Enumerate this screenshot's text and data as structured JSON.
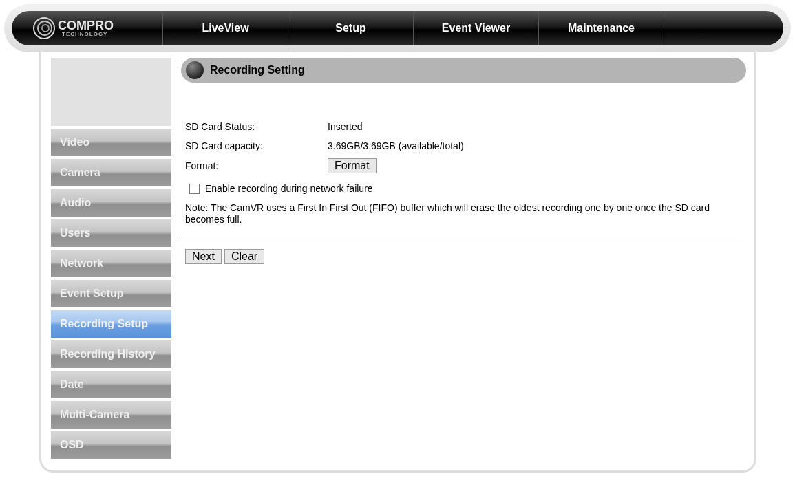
{
  "logo": {
    "name": "COMPRO",
    "tagline": "TECHNOLOGY"
  },
  "nav": [
    {
      "label": "LiveView",
      "selected": false
    },
    {
      "label": "Setup",
      "selected": false
    },
    {
      "label": "Event Viewer",
      "selected": false
    },
    {
      "label": "Maintenance",
      "selected": false
    }
  ],
  "sidebar": {
    "items": [
      {
        "label": "Video",
        "selected": false
      },
      {
        "label": "Camera",
        "selected": false
      },
      {
        "label": "Audio",
        "selected": false
      },
      {
        "label": "Users",
        "selected": false
      },
      {
        "label": "Network",
        "selected": false
      },
      {
        "label": "Event Setup",
        "selected": false
      },
      {
        "label": "Recording Setup",
        "selected": true
      },
      {
        "label": "Recording History",
        "selected": false
      },
      {
        "label": "Date",
        "selected": false
      },
      {
        "label": "Multi-Camera",
        "selected": false
      },
      {
        "label": "OSD",
        "selected": false
      }
    ]
  },
  "section_title": "Recording Setting",
  "fields": [
    {
      "kind": "text",
      "label": "SD Card Status:",
      "value": "Inserted"
    },
    {
      "kind": "text",
      "label": "SD Card capacity:",
      "value": "3.69GB/3.69GB (available/total)"
    },
    {
      "kind": "button",
      "label": "Format:",
      "value": "Format"
    }
  ],
  "checkbox": {
    "label": "Enable recording during network failure",
    "checked": false
  },
  "note": "Note: The CamVR uses a First In First Out (FIFO) buffer which will erase the oldest recording one by one once the SD card becomes full.",
  "buttons": [
    "Next",
    "Clear"
  ]
}
